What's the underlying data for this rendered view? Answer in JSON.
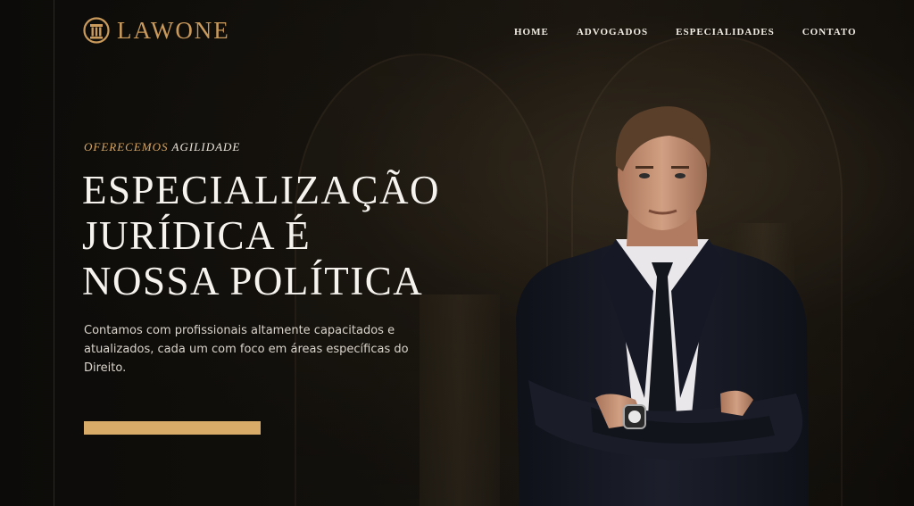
{
  "brand": {
    "name": "LAWONE",
    "accent": "#c99a5b"
  },
  "nav": {
    "items": [
      {
        "label": "HOME"
      },
      {
        "label": "ADVOGADOS"
      },
      {
        "label": "ESPECIALIDADES"
      },
      {
        "label": "CONTATO"
      }
    ]
  },
  "hero": {
    "eyebrow_highlight": "OFERECEMOS",
    "eyebrow_rest": "AGILIDADE",
    "headline": [
      "ESPECIALIZAÇÃO",
      "JURÍDICA É",
      "NOSSA POLÍTICA"
    ],
    "description": "Contamos com profissionais altamente capacitados e atualizados, cada um com foco em áreas específicas do Direito.",
    "cta_color": "#d8ab69"
  },
  "icons": {
    "logo": "courthouse-pillar-icon"
  }
}
